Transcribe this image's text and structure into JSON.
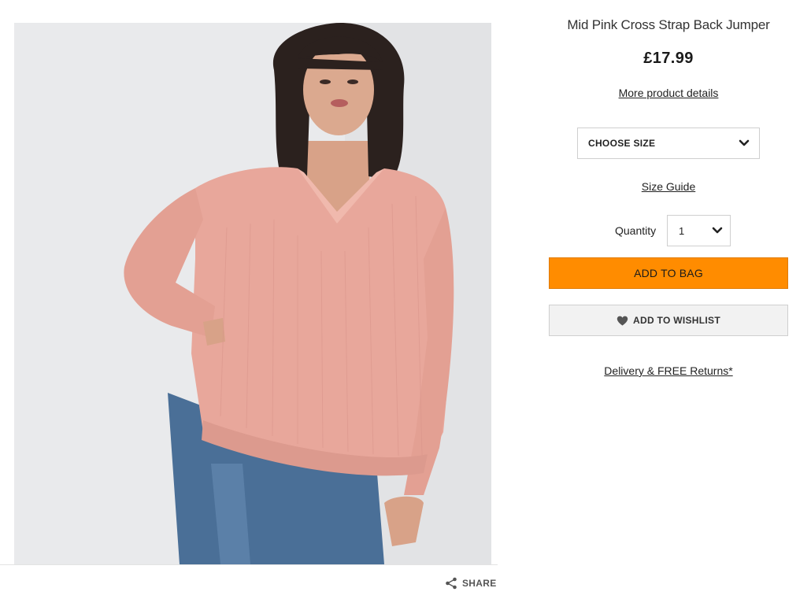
{
  "product": {
    "title": "Mid Pink Cross Strap Back Jumper",
    "price": "£17.99",
    "details_link": "More product details",
    "image": {
      "icon": "product-photo-pink-jumper",
      "background_color": "#e8e9eb",
      "garment_color": "#e8a79b"
    }
  },
  "size": {
    "label": "CHOOSE SIZE",
    "guide_link": "Size Guide",
    "icon": "chevron-down-icon"
  },
  "quantity": {
    "label": "Quantity",
    "value": "1",
    "icon": "chevron-down-icon"
  },
  "actions": {
    "add_to_bag": "ADD TO BAG",
    "add_to_bag_color": "#ff8c00",
    "wishlist": "ADD TO WISHLIST",
    "wishlist_icon": "heart-icon"
  },
  "delivery_link": "Delivery & FREE Returns*",
  "share": {
    "label": "SHARE",
    "icon": "share-icon"
  }
}
